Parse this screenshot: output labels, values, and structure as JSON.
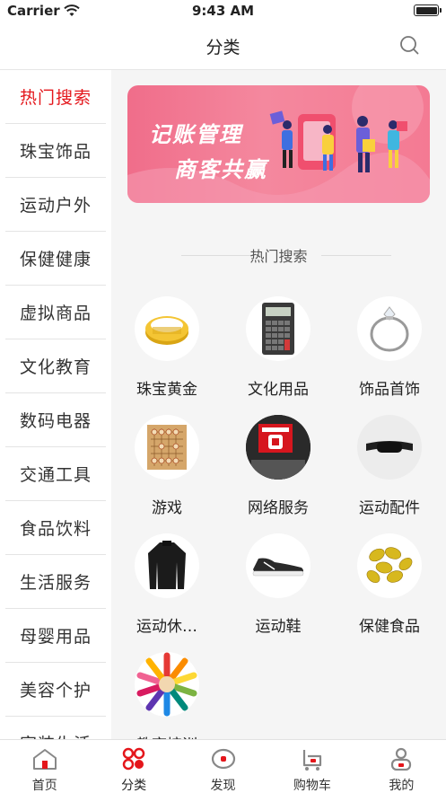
{
  "status_bar": {
    "carrier": "Carrier",
    "time": "9:43 AM"
  },
  "navbar": {
    "title": "分类"
  },
  "sidebar": {
    "items": [
      {
        "label": "热门搜索",
        "active": true
      },
      {
        "label": "珠宝饰品"
      },
      {
        "label": "运动户外"
      },
      {
        "label": "保健健康"
      },
      {
        "label": "虚拟商品"
      },
      {
        "label": "文化教育"
      },
      {
        "label": "数码电器"
      },
      {
        "label": "交通工具"
      },
      {
        "label": "食品饮料"
      },
      {
        "label": "生活服务"
      },
      {
        "label": "母婴用品"
      },
      {
        "label": "美容个护"
      },
      {
        "label": "家装生活"
      }
    ]
  },
  "banner": {
    "line1": "记账管理",
    "line2": "商客共赢"
  },
  "section": {
    "title": "热门搜索"
  },
  "categories": [
    {
      "label": "珠宝黄金",
      "icon": "gold-ring-icon"
    },
    {
      "label": "文化用品",
      "icon": "calculator-icon"
    },
    {
      "label": "饰品首饰",
      "icon": "diamond-ring-icon"
    },
    {
      "label": "游戏",
      "icon": "chess-board-icon"
    },
    {
      "label": "网络服务",
      "icon": "internet-sign-icon"
    },
    {
      "label": "运动配件",
      "icon": "waist-bag-icon"
    },
    {
      "label": "运动休…",
      "icon": "sport-jacket-icon"
    },
    {
      "label": "运动鞋",
      "icon": "sneaker-icon"
    },
    {
      "label": "保健食品",
      "icon": "capsules-icon"
    },
    {
      "label": "教育培训",
      "icon": "colored-pencils-icon"
    }
  ],
  "tabbar": {
    "tabs": [
      {
        "label": "首页",
        "icon": "home-icon"
      },
      {
        "label": "分类",
        "icon": "category-icon",
        "active": true
      },
      {
        "label": "发现",
        "icon": "discover-icon"
      },
      {
        "label": "购物车",
        "icon": "cart-icon"
      },
      {
        "label": "我的",
        "icon": "profile-icon"
      }
    ]
  },
  "colors": {
    "accent": "#e4161b",
    "banner": "#f47a93",
    "content_bg": "#f5f5f5"
  }
}
